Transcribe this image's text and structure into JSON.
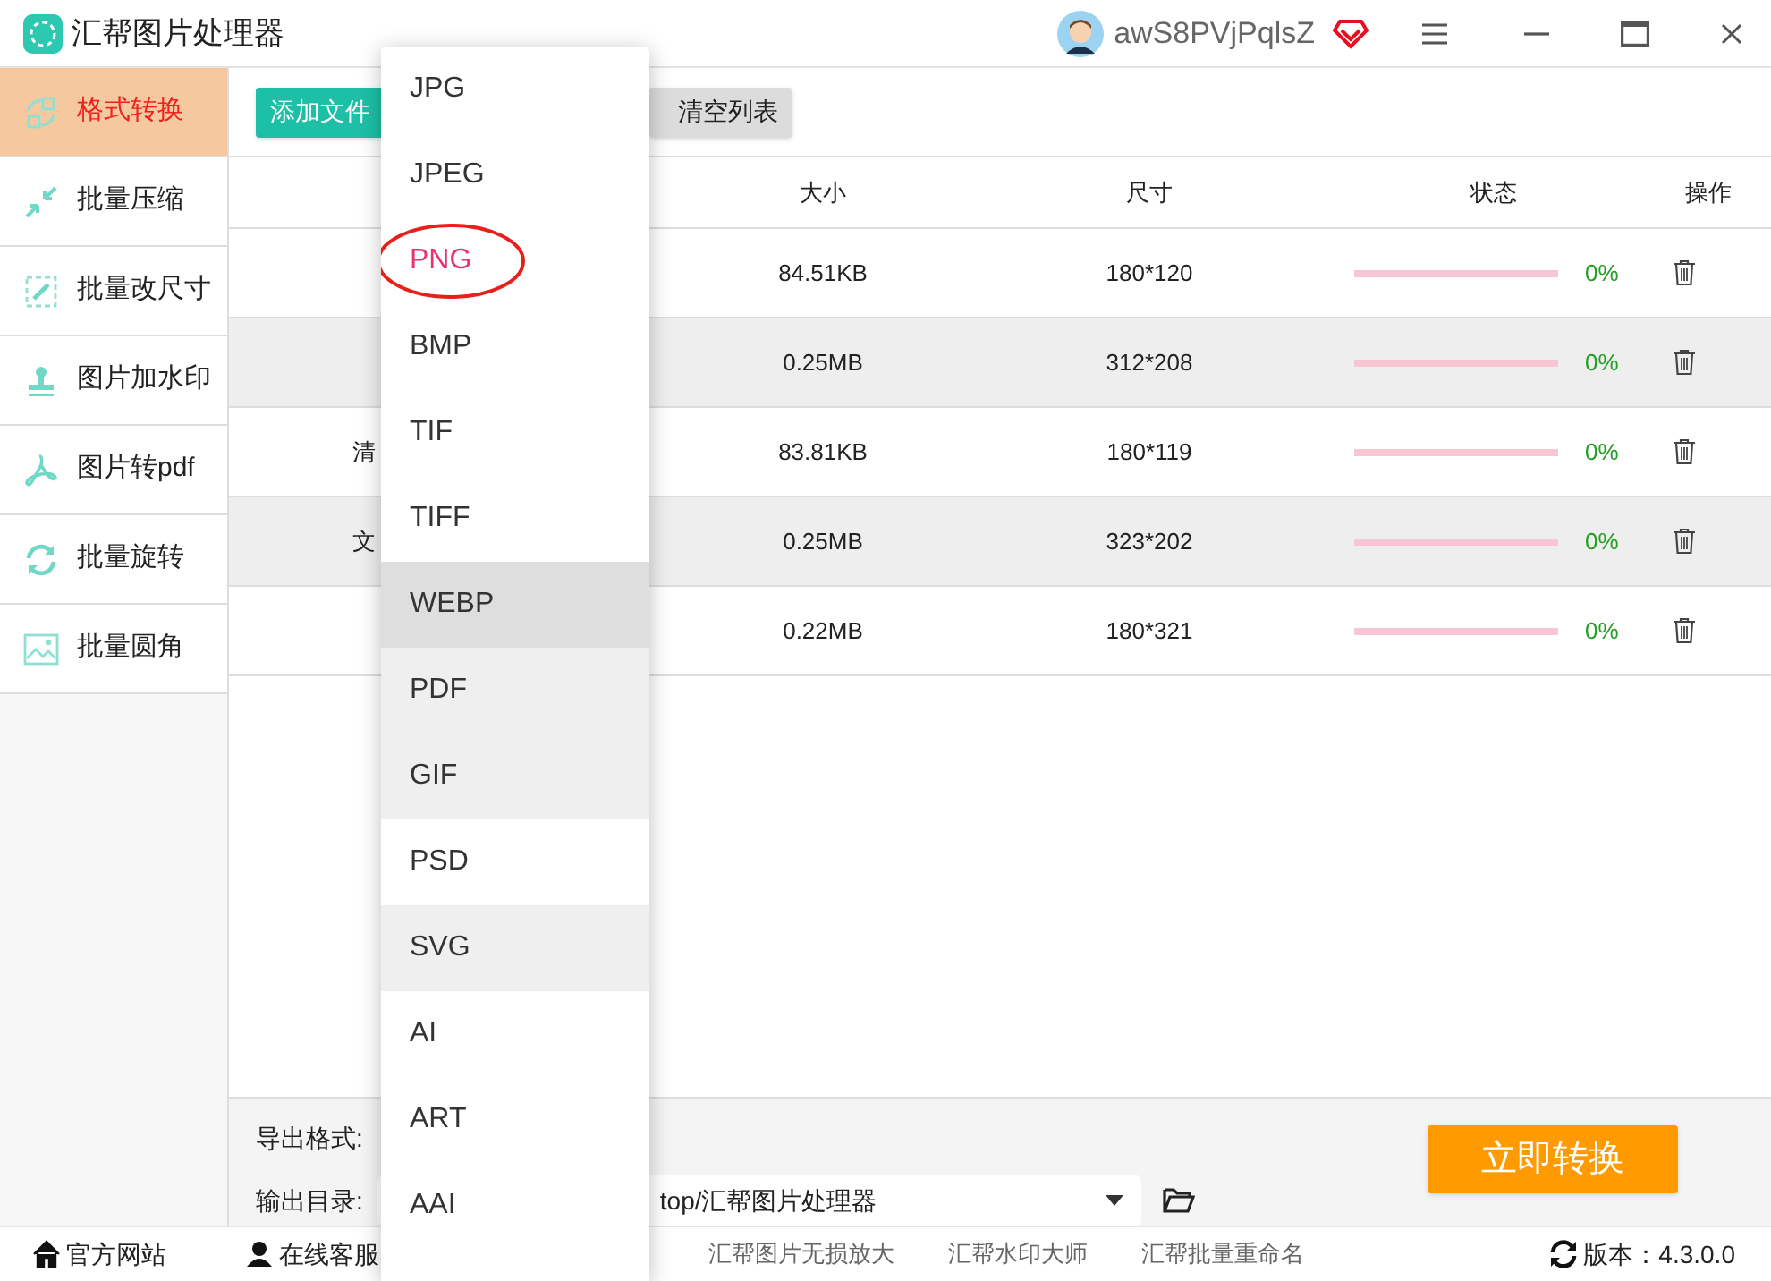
{
  "window": {
    "title": "汇帮图片处理器",
    "user": "awS8PVjPqlsZ"
  },
  "sidebar": {
    "items": [
      {
        "label": "格式转换",
        "selected": true
      },
      {
        "label": "批量压缩",
        "selected": false
      },
      {
        "label": "批量改尺寸",
        "selected": false
      },
      {
        "label": "图片加水印",
        "selected": false
      },
      {
        "label": "图片转pdf",
        "selected": false
      },
      {
        "label": "批量旋转",
        "selected": false
      },
      {
        "label": "批量圆角",
        "selected": false
      }
    ]
  },
  "toolbar": {
    "add_button": "添加文件",
    "clear_button": "清空列表"
  },
  "table": {
    "columns": [
      "大小",
      "尺寸",
      "状态",
      "操作"
    ],
    "rows": [
      {
        "size": "84.51KB",
        "dimensions": "180*120",
        "level": 0,
        "progress": "0%"
      },
      {
        "size": "0.25MB",
        "dimensions": "312*208",
        "level": 0,
        "progress": "0%"
      },
      {
        "name": "清",
        "size": "83.81KB",
        "dimensions": "180*119",
        "level": 0,
        "progress": "0%"
      },
      {
        "name": "文",
        "size": "0.25MB",
        "dimensions": "323*202",
        "level": 0,
        "progress": "0%"
      },
      {
        "size": "0.22MB",
        "dimensions": "180*321",
        "level": 0,
        "progress": "0%"
      }
    ]
  },
  "output": {
    "format_label": "导出格式:",
    "dir_label": "输出目录:",
    "dir_value": "top/汇帮图片处理器",
    "convert_button": "立即转换"
  },
  "format_menu": [
    {
      "label": "JPG",
      "selected": false,
      "hovered": false,
      "shaded": false
    },
    {
      "label": "JPEG",
      "selected": false,
      "hovered": false,
      "shaded": false
    },
    {
      "label": "PNG",
      "selected": true,
      "hovered": false,
      "shaded": false
    },
    {
      "label": "BMP",
      "selected": false,
      "hovered": false,
      "shaded": false
    },
    {
      "label": "TIF",
      "selected": false,
      "hovered": false,
      "shaded": false
    },
    {
      "label": "TIFF",
      "selected": false,
      "hovered": false,
      "shaded": false
    },
    {
      "label": "WEBP",
      "selected": false,
      "hovered": true,
      "shaded": false
    },
    {
      "label": "PDF",
      "selected": false,
      "hovered": false,
      "shaded": true
    },
    {
      "label": "GIF",
      "selected": false,
      "hovered": false,
      "shaded": true
    },
    {
      "label": "PSD",
      "selected": false,
      "hovered": false,
      "shaded": false
    },
    {
      "label": "SVG",
      "selected": false,
      "hovered": false,
      "shaded": true
    },
    {
      "label": "AI",
      "selected": false,
      "hovered": false,
      "shaded": false
    },
    {
      "label": "ART",
      "selected": false,
      "hovered": false,
      "shaded": false
    },
    {
      "label": "AAI",
      "selected": false,
      "hovered": false,
      "shaded": false
    }
  ],
  "footer": {
    "links": [
      {
        "label": "官方网站"
      },
      {
        "label": "在线客服"
      }
    ],
    "products": [
      "汇帮图片无损放大",
      "汇帮水印大师",
      "汇帮批量重命名"
    ],
    "version": "版本：4.3.0.0"
  }
}
